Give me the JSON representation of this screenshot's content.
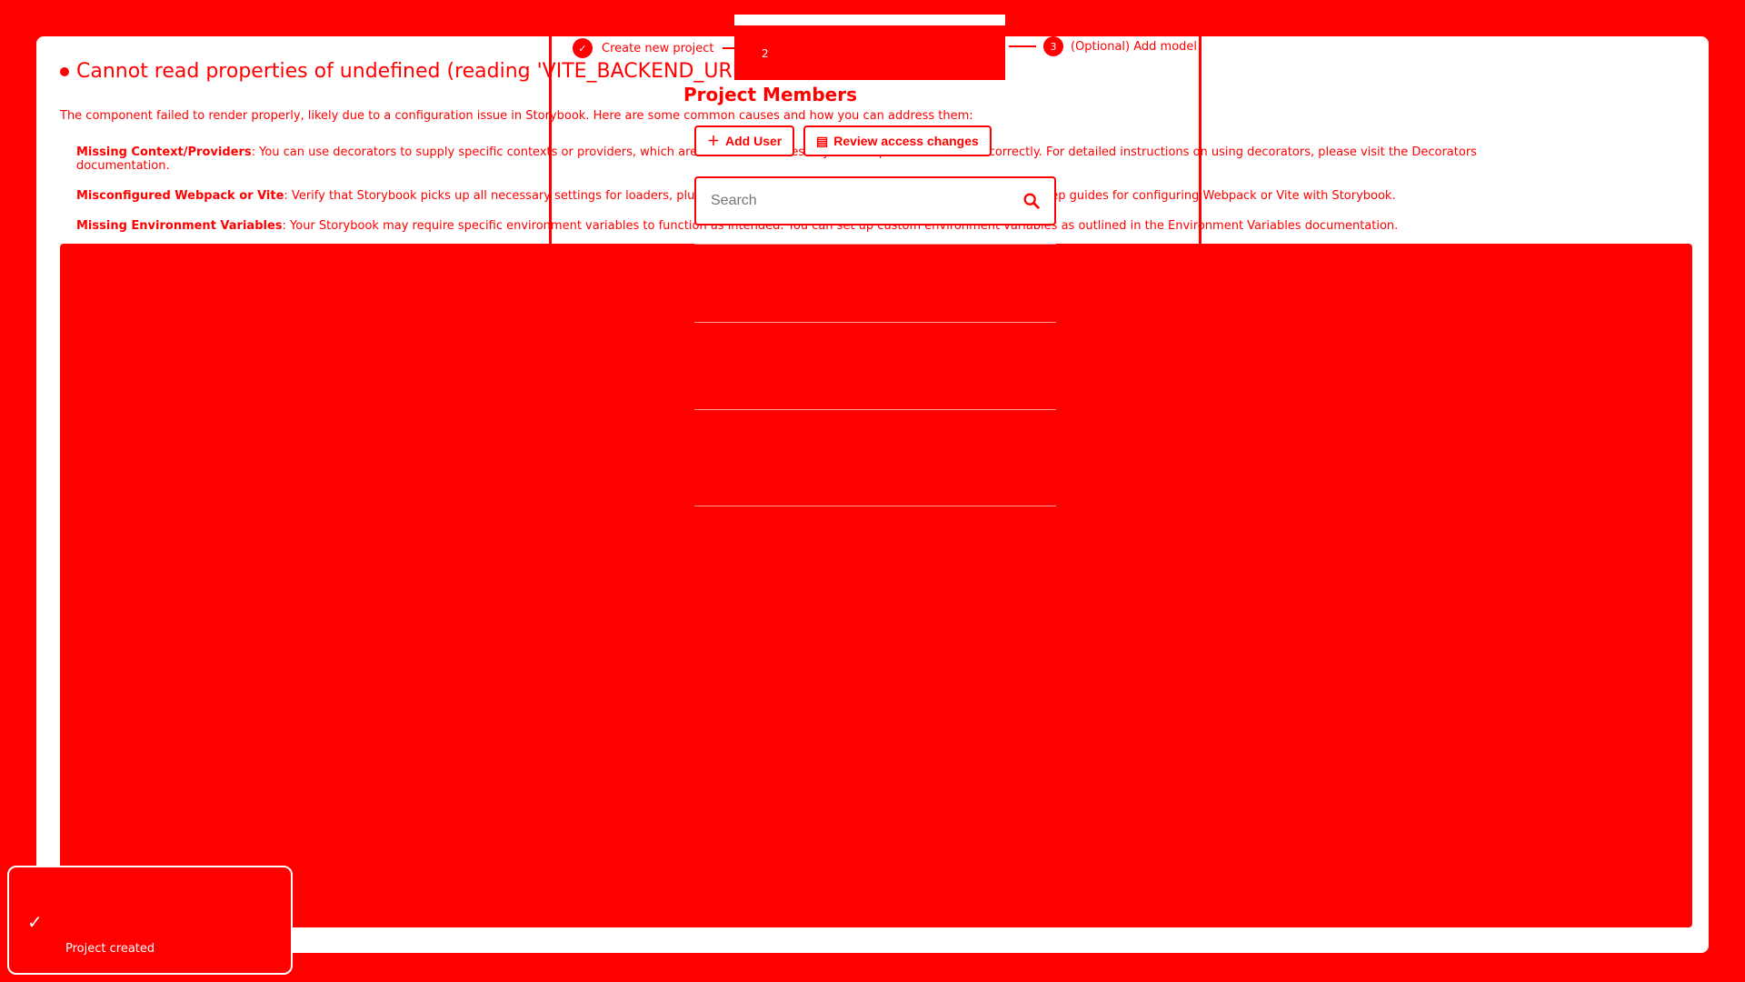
{
  "error": {
    "title": "Cannot read properties of undefined (reading 'VITE_BACKEND_URL')",
    "description": "The component failed to render properly, likely due to a configuration issue in Storybook. Here are some common causes and how you can address them:",
    "items": [
      {
        "label": "Missing Context/Providers",
        "text": ": You can use decorators to supply specific contexts or providers, which are sometimes necessary for components to render correctly. For detailed instructions on using decorators, please visit the Decorators documentation."
      },
      {
        "label": "Misconfigured Webpack or Vite",
        "text": ": Verify that Storybook picks up all necessary settings for loaders, plugins, and other relevant parameters. You can find step-by-step guides for configuring Webpack or Vite with Storybook."
      },
      {
        "label": "Missing Environment Variables",
        "text": ": Your Storybook may require specific environment variables to function as intended. You can set up custom environment variables as outlined in the Environment Variables documentation."
      }
    ]
  },
  "stepper": {
    "step1_label": "Create new project",
    "step2_number": "2",
    "step3_number": "3",
    "step3_label": "(Optional) Add model"
  },
  "members": {
    "title": "Project Members",
    "add_user_label": "Add User",
    "review_label": "Review access changes",
    "search_placeholder": "Search"
  },
  "toast": {
    "message": "Project created"
  },
  "colors": {
    "accent": "#ff0000",
    "background": "#ffffff"
  }
}
